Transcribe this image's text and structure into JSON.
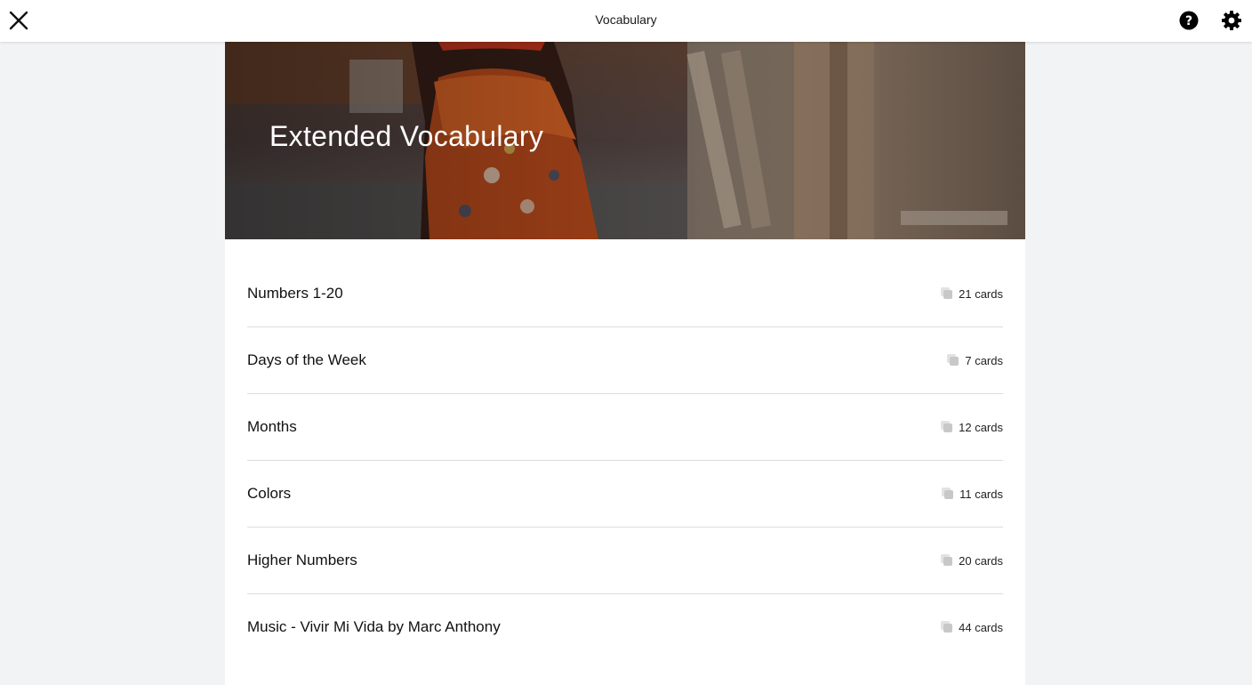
{
  "header": {
    "title": "Vocabulary",
    "close_icon": "close-icon",
    "help_icon": "help-icon",
    "settings_icon": "gear-icon"
  },
  "hero": {
    "title": "Extended Vocabulary"
  },
  "decks": [
    {
      "title": "Numbers 1-20",
      "count": "21 cards"
    },
    {
      "title": "Days of the Week",
      "count": "7 cards"
    },
    {
      "title": "Months",
      "count": "12 cards"
    },
    {
      "title": "Colors",
      "count": "11 cards"
    },
    {
      "title": "Higher Numbers",
      "count": "20 cards"
    },
    {
      "title": "Music - Vivir Mi Vida by Marc Anthony",
      "count": "44 cards"
    }
  ],
  "colors": {
    "background": "#f2f3f5",
    "panel": "#ffffff",
    "divider": "#dcdcdc",
    "icon": "#000000"
  }
}
